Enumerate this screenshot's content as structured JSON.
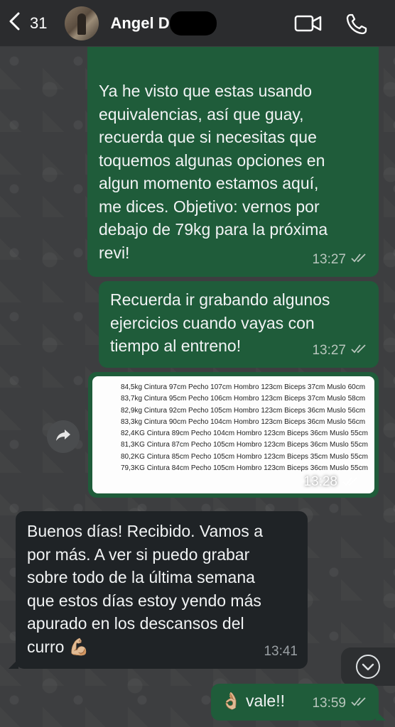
{
  "header": {
    "back_count": "31",
    "contact_name": "Angel D"
  },
  "messages": [
    {
      "direction": "outgoing",
      "text": "Ya he visto que estas usando\nequivalencias, así que guay,\nrecuerda que si necesitas que\ntoquemos algunas opciones en\nalgun momento estamos aquí,\nme dices. Objetivo: vernos por\ndebajo de 79kg para la próxima\nrevi!",
      "time": "13:27"
    },
    {
      "direction": "outgoing",
      "text": "Recuerda ir grabando algunos\nejercicios cuando vayas con\ntiempo al entreno!",
      "time": "13:27"
    },
    {
      "direction": "outgoing",
      "type": "image",
      "image_rows": [
        "84,5kg Cintura 97cm Pecho 107cm Hombro 123cm Biceps 37cm Muslo 60cm",
        "83,7kg Cintura 95cm Pecho 106cm Hombro 123cm Biceps 37cm Muslo 58cm",
        "82,9kg Cintura 92cm Pecho 105cm Hombro 123cm Biceps 36cm Muslo 56cm",
        "83,3kg Cintura 90cm Pecho 104cm Hombro 123cm Biceps 36cm Muslo 56cm",
        "82,4KG Cintura 89cm Pecho 104cm Hombro 123cm Biceps 36cm Muslo 55cm",
        "81,3KG Cintura 87cm Pecho 105cm Hombro 123cm Biceps 36cm Muslo 55cm",
        "80,2KG Cintura 85cm Pecho 105cm Hombro 123cm Biceps 35cm Muslo 55cm",
        "79,3KG Cintura 84cm Pecho 105cm Hombro 123cm Biceps 36cm Muslo 55cm"
      ],
      "time": "13:28"
    },
    {
      "direction": "incoming",
      "text": "Buenos días! Recibido. Vamos a\npor más. A ver si puedo grabar\nsobre todo de la última semana\nque estos días estoy yendo más\napurado en los descansos del\ncurro 💪🏼",
      "time": "13:41"
    },
    {
      "direction": "outgoing",
      "text": "👌🏼 vale!!",
      "time": "13:59"
    }
  ],
  "icons": {
    "back": "chevron-left-icon",
    "video": "video-camera-icon",
    "call": "phone-icon",
    "forward": "forward-arrow-icon",
    "scroll_down": "chevron-down-icon",
    "read": "double-check-icon"
  },
  "colors": {
    "outgoing_bubble": "#1f5c3a",
    "incoming_bubble": "#1f2326",
    "header": "#2b2c2e"
  }
}
